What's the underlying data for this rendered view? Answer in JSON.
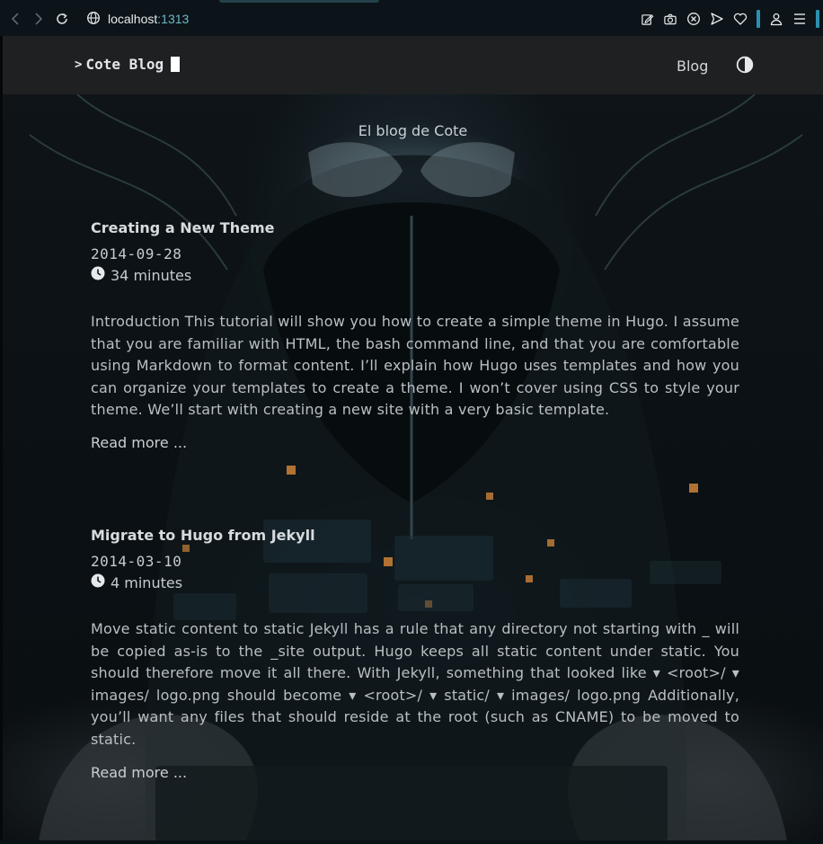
{
  "browser": {
    "url_host": "localhost",
    "url_port": ":1313"
  },
  "site": {
    "logo": {
      "prompt": ">",
      "text": "Cote Blog"
    },
    "menu": {
      "blog_label": "Blog"
    },
    "tagline": "El blog de Cote"
  },
  "posts": [
    {
      "title": "Creating a New Theme",
      "date": "2014-09-28",
      "reading_time": "34 minutes",
      "summary": "Introduction This tutorial will show you how to create a simple theme in Hugo. I assume that you are familiar with HTML, the bash command line, and that you are comfortable using Markdown to format content. I’ll explain how Hugo uses templates and how you can organize your templates to create a theme. I won’t cover using CSS to style your theme. We’ll start with creating a new site with a very basic template.",
      "read_more": "Read more ..."
    },
    {
      "title": "Migrate to Hugo from Jekyll",
      "date": "2014-03-10",
      "reading_time": "4 minutes",
      "summary": "Move static content to static Jekyll has a rule that any directory not starting with _ will be copied as-is to the _site output. Hugo keeps all static content under static. You should therefore move it all there. With Jekyll, something that looked like ▾ <root>/ ▾ images/ logo.png should become ▾ <root>/ ▾ static/ ▾ images/ logo.png Additionally, you’ll want any files that should reside at the root (such as CNAME) to be moved to static.",
      "read_more": "Read more ..."
    }
  ],
  "colors": {
    "chrome_bg": "#0c1419",
    "header_bg": "#1e2022",
    "accent": "#2d8fb0",
    "text": "#c9ced2"
  }
}
